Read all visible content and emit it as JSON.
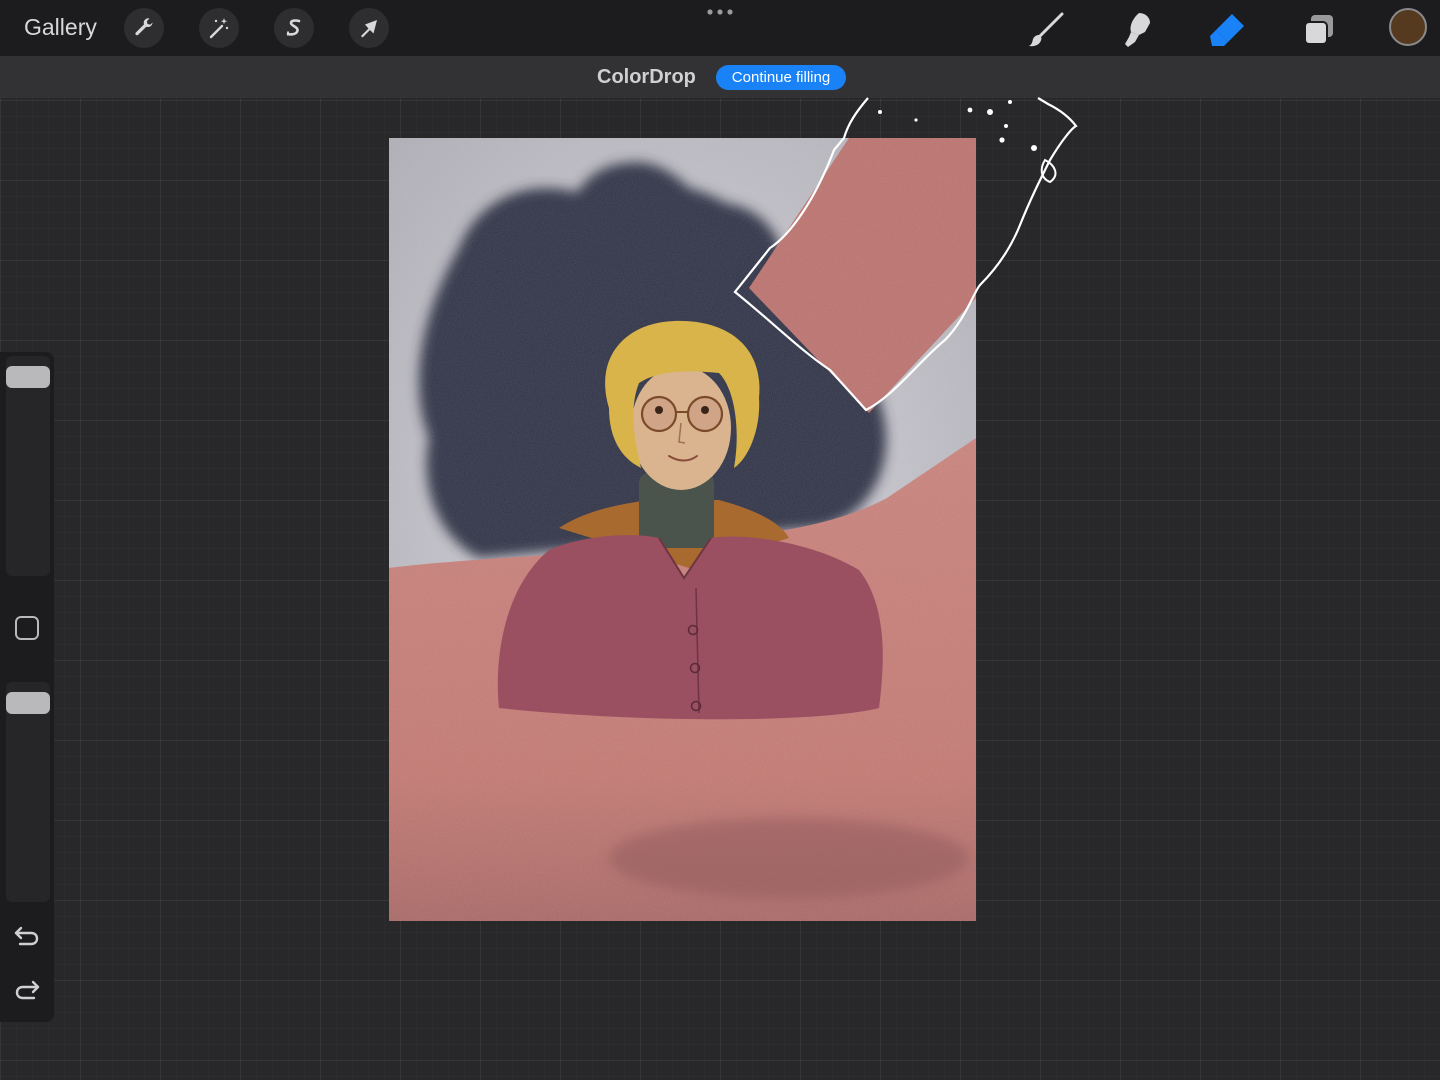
{
  "toolbar": {
    "gallery_label": "Gallery",
    "left_tools": [
      {
        "name": "wrench-icon",
        "label": "Actions"
      },
      {
        "name": "magic-wand-icon",
        "label": "Adjustments"
      },
      {
        "name": "selection-s-icon",
        "label": "Selection"
      },
      {
        "name": "arrow-cursor-icon",
        "label": "Transform"
      }
    ],
    "more_icon": "ellipsis-icon",
    "right_tools": [
      {
        "name": "brush-icon",
        "active": false
      },
      {
        "name": "smudge-icon",
        "active": false
      },
      {
        "name": "eraser-icon",
        "active": true
      },
      {
        "name": "layers-icon",
        "active": false
      }
    ],
    "current_color": "#553a20",
    "active_color": "#1a82f7"
  },
  "banner": {
    "title": "ColorDrop",
    "continue_label": "Continue filling",
    "button_color": "#1a82f7"
  },
  "sidebar": {
    "brush_size": 0.95,
    "opacity": 0.95,
    "modify_icon": "square-icon",
    "undo_icon": "undo-icon",
    "redo_icon": "redo-icon"
  },
  "canvas": {
    "artwork_name": "portrait-illustration",
    "colors": {
      "background_grey": "#c9c8cf",
      "watercolor_navy": "#2f3345",
      "fill_rose": "#c17a72",
      "shirt_magenta": "#9a5060",
      "hair_gold": "#d8b44a",
      "skin": "#d9b48f",
      "turtleneck": "#4a544c",
      "jacket": "#a86a2e"
    }
  }
}
